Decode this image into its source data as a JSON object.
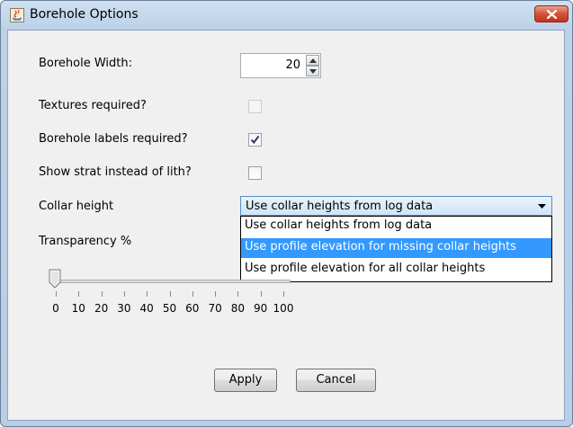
{
  "window": {
    "title": "Borehole Options",
    "app_icon": "java-app-icon",
    "close_icon": "close-icon",
    "close_color": "#c7432a"
  },
  "form": {
    "borehole_width_label": "Borehole Width:",
    "borehole_width_value": "20",
    "textures_label": "Textures required?",
    "textures_checked": false,
    "textures_enabled": false,
    "labels_label": "Borehole labels required?",
    "labels_checked": true,
    "strat_label": "Show strat instead of lith?",
    "strat_checked": false,
    "collar_label": "Collar height",
    "collar_selected": "Use collar heights from log data",
    "collar_options": [
      "Use collar heights from log data",
      "Use profile elevation for missing collar heights",
      "Use profile elevation for all collar heights"
    ],
    "collar_highlighted_index": 1,
    "transparency_label": "Transparency %",
    "transparency_value": 0,
    "transparency_ticks": [
      "0",
      "10",
      "20",
      "30",
      "40",
      "50",
      "60",
      "70",
      "80",
      "90",
      "100"
    ]
  },
  "buttons": {
    "apply": "Apply",
    "cancel": "Cancel"
  },
  "colors": {
    "title_bar": "#bdd2e9",
    "selection": "#3399ff",
    "client_bg": "#f0f0f0"
  }
}
